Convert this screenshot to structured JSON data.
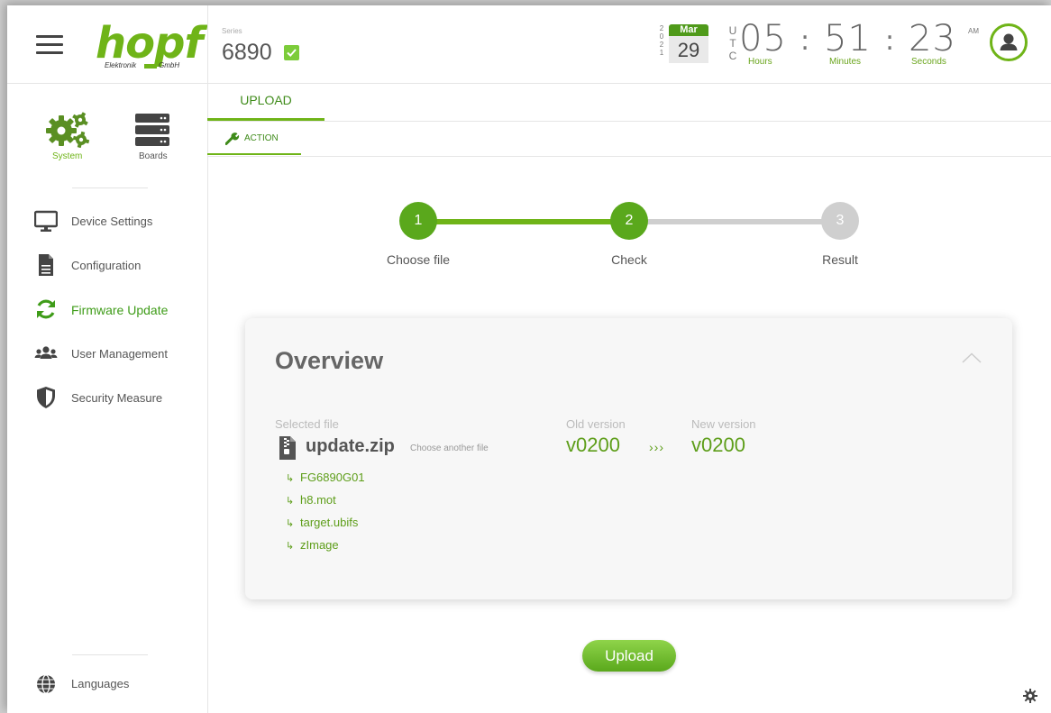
{
  "header": {
    "logo": {
      "word": "hopf",
      "left_text": "Elektronik",
      "right_text": "GmbH"
    },
    "series_label": "Series",
    "series_number": "6890",
    "year_digits": [
      "2",
      "0",
      "2",
      "1"
    ],
    "date": {
      "month": "Mar",
      "day": "29"
    },
    "utc_letters": [
      "U",
      "T",
      "C"
    ],
    "time": {
      "hours": "05",
      "minutes": "51",
      "seconds": "23",
      "ampm": "AM",
      "sep": ":"
    },
    "time_labels": {
      "hours": "Hours",
      "minutes": "Minutes",
      "seconds": "Seconds"
    }
  },
  "sidebar": {
    "top": [
      {
        "label": "System",
        "icon": "gears-icon",
        "active": true
      },
      {
        "label": "Boards",
        "icon": "server-icon",
        "active": false
      }
    ],
    "items": [
      {
        "label": "Device Settings",
        "icon": "monitor-icon"
      },
      {
        "label": "Configuration",
        "icon": "document-icon"
      },
      {
        "label": "Firmware Update",
        "icon": "refresh-icon",
        "active": true
      },
      {
        "label": "User Management",
        "icon": "users-icon"
      },
      {
        "label": "Security Measure",
        "icon": "shield-icon"
      }
    ],
    "languages_label": "Languages"
  },
  "tabs": {
    "upload": "UPLOAD",
    "action": "ACTION"
  },
  "steps": [
    {
      "number": "1",
      "label": "Choose file",
      "state": "done"
    },
    {
      "number": "2",
      "label": "Check",
      "state": "current"
    },
    {
      "number": "3",
      "label": "Result",
      "state": "pending"
    }
  ],
  "overview": {
    "title": "Overview",
    "selected_file_label": "Selected file",
    "file_name": "update.zip",
    "choose_another": "Choose another file",
    "old_version_label": "Old version",
    "old_version": "v0200",
    "arrows": "›››",
    "new_version_label": "New version",
    "new_version": "v0200",
    "files": [
      "FG6890G01",
      "h8.mot",
      "target.ubifs",
      "zImage"
    ]
  },
  "upload_button": "Upload",
  "colors": {
    "accent": "#6fb418",
    "accent_dark": "#3f8b1a",
    "pending": "#cfcfcf"
  }
}
